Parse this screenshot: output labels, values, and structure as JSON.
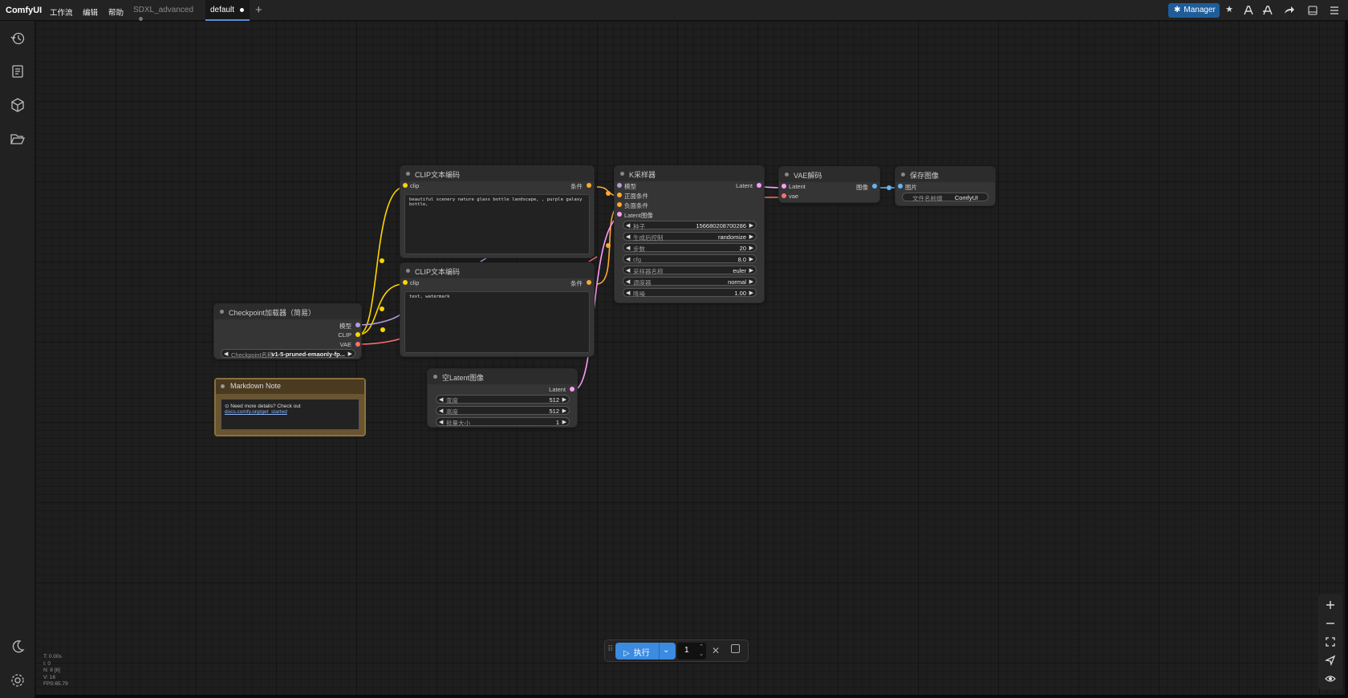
{
  "app": {
    "name": "ComfyUI"
  },
  "menu": [
    "工作流",
    "编辑",
    "帮助"
  ],
  "tabs": [
    {
      "label": "SDXL_advanced",
      "active": false
    },
    {
      "label": "default",
      "active": true
    }
  ],
  "topbar_right": {
    "manager_label": "Manager",
    "icons": [
      "star-icon",
      "model-library-icon",
      "node-library-icon",
      "share-icon",
      "panel-toggle-icon",
      "menu-icon"
    ]
  },
  "sidebar_icons": [
    "history-icon",
    "node-library-icon",
    "model-library-icon",
    "workflows-icon",
    "theme-icon",
    "settings-icon"
  ],
  "nodes": {
    "clip1": {
      "title": "CLIP文本编码",
      "input": "clip",
      "output": "条件",
      "text": "beautiful scenery nature glass bottle landscape, , purple galaxy bottle,"
    },
    "clip2": {
      "title": "CLIP文本编码",
      "input": "clip",
      "output": "条件",
      "text": "text, watermark"
    },
    "ksampler": {
      "title": "K采样器",
      "inputs": [
        "模型",
        "正面条件",
        "负面条件",
        "Latent图像"
      ],
      "output": "Latent",
      "widgets": [
        {
          "label": "种子",
          "value": "156680208700286"
        },
        {
          "label": "生成后控制",
          "value": "randomize"
        },
        {
          "label": "步数",
          "value": "20"
        },
        {
          "label": "cfg",
          "value": "8.0"
        },
        {
          "label": "采样器名称",
          "value": "euler"
        },
        {
          "label": "调度器",
          "value": "normal"
        },
        {
          "label": "降噪",
          "value": "1.00"
        }
      ]
    },
    "vae": {
      "title": "VAE解码",
      "inputs": [
        "Latent",
        "vae"
      ],
      "output": "图像"
    },
    "save": {
      "title": "保存图像",
      "input": "图片",
      "widget": {
        "label": "文件名前缀",
        "value": "ComfyUI"
      }
    },
    "checkpoint": {
      "title": "Checkpoint加载器（简易）",
      "outputs": [
        "模型",
        "CLIP",
        "VAE"
      ],
      "widget": {
        "label": "Checkpoint名称",
        "value": "v1-5-pruned-emaonly-fp..."
      }
    },
    "note": {
      "title": "Markdown Note",
      "text_prefix": "⊙ Need more details? Check out ",
      "link": "docs.comfy.org/get_started"
    },
    "latent": {
      "title": "空Latent图像",
      "output": "Latent",
      "widgets": [
        {
          "label": "宽度",
          "value": "512"
        },
        {
          "label": "高度",
          "value": "512"
        },
        {
          "label": "批量大小",
          "value": "1"
        }
      ]
    }
  },
  "runbar": {
    "run_label": "执行",
    "queue_count": "1"
  },
  "right_tools": [
    "zoom-in-icon",
    "zoom-out-icon",
    "fit-view-icon",
    "select-mode-icon",
    "toggle-link-visibility-icon"
  ],
  "stats": [
    "T: 0.00s",
    "I: 0",
    "N: 8 [8]",
    "V: 16",
    "FPS:65.79"
  ],
  "colors": {
    "clip": "#FFD500",
    "model": "#B39DDB",
    "vae": "#FF6E6E",
    "latent": "#FF9CF9",
    "conditioning": "#FFA931",
    "image": "#64B5F6",
    "accent": "#3b8be0"
  }
}
